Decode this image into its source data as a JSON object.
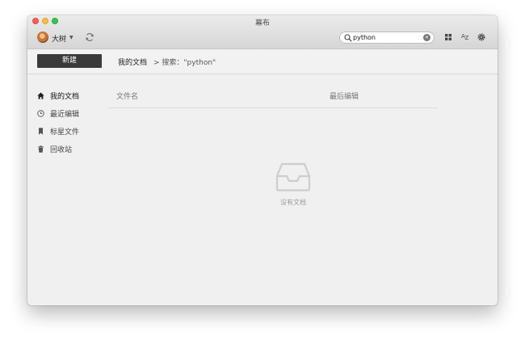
{
  "window": {
    "title": "幕布"
  },
  "user": {
    "name": "大树"
  },
  "search": {
    "value": "python"
  },
  "toolbar": {
    "new_label": "新建",
    "breadcrumb_root": "我的文档",
    "breadcrumb_search": "> 搜索：\"python\""
  },
  "sidebar": {
    "items": [
      {
        "label": "我的文档",
        "icon": "home-icon",
        "active": true
      },
      {
        "label": "最近编辑",
        "icon": "clock-icon",
        "active": false
      },
      {
        "label": "标星文件",
        "icon": "bookmark-icon",
        "active": false
      },
      {
        "label": "回收站",
        "icon": "trash-icon",
        "active": false
      }
    ]
  },
  "table": {
    "columns": [
      "文件名",
      "最后编辑"
    ]
  },
  "empty_state": {
    "text": "没有文档",
    "icon": "empty-inbox-icon"
  },
  "colors": {
    "accent": "#3a3a3a",
    "background": "#f0f0f0"
  }
}
